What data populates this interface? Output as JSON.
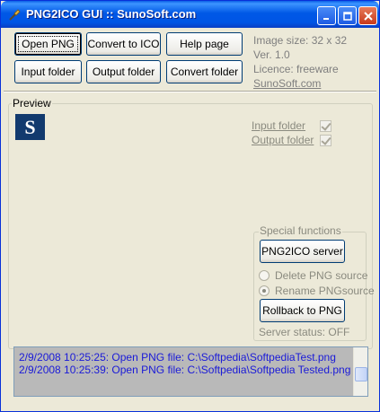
{
  "window": {
    "title": "PNG2ICO GUI :: SunoSoft.com"
  },
  "toolbar": {
    "open_png": "Open PNG",
    "convert_to_ico": "Convert to ICO",
    "help_page": "Help page",
    "input_folder": "Input folder",
    "output_folder": "Output folder",
    "convert_folder": "Convert folder"
  },
  "info": {
    "image_size": "Image size: 32 x 32",
    "version": "Ver. 1.0",
    "licence": "Licence: freeware",
    "site_link": "SunoSoft.com"
  },
  "preview": {
    "label": "Preview",
    "logo_letter": "S",
    "input_folder_label": "Input folder",
    "output_folder_label": "Output folder",
    "input_folder_checked": true,
    "output_folder_checked": true
  },
  "special": {
    "label": "Special functions",
    "server_button": "PNG2ICO server",
    "delete_option": "Delete PNG source",
    "rename_option": "Rename PNGsource",
    "selected_option": "Rename PNGsource",
    "rollback_button": "Rollback to PNG",
    "server_status": "Server status: OFF"
  },
  "log": {
    "lines": [
      "2/9/2008 10:25:25: Open PNG file: C:\\Softpedia\\SoftpediaTest.png",
      "2/9/2008 10:25:39: Open PNG file: C:\\Softpedia\\Softpedia Tested.png"
    ]
  },
  "colors": {
    "titlebar": "#0058e6",
    "log_text": "#1a1ad8",
    "logo_bg": "#123a6e"
  }
}
